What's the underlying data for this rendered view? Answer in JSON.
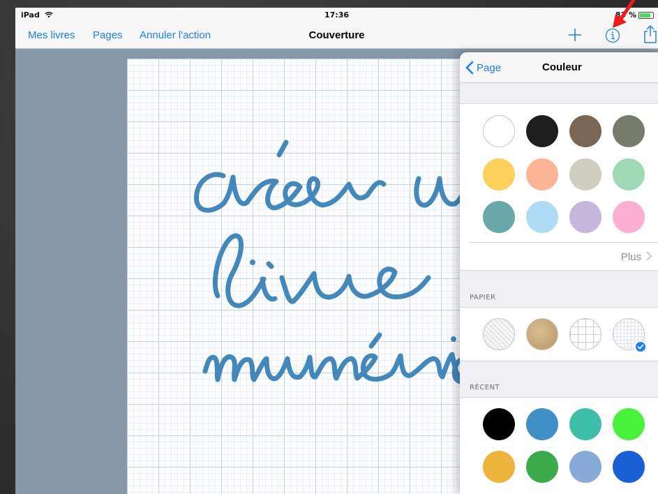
{
  "status": {
    "device": "iPad",
    "time": "17:36",
    "battery_text": "83 %",
    "battery_level": 0.83
  },
  "nav": {
    "back_books": "Mes livres",
    "pages": "Pages",
    "undo": "Annuler l'action",
    "title": "Couverture",
    "icons": [
      "plus-icon",
      "info-icon",
      "share-icon"
    ]
  },
  "canvas": {
    "handwriting": [
      "créer un",
      "livre",
      "numérique"
    ],
    "ink_color": "#4488bb"
  },
  "popover": {
    "back_label": "Page",
    "title": "Couleur",
    "colors": [
      "#ffffff",
      "#1e1e1e",
      "#7a6654",
      "#767c6c",
      "#fdcf5b",
      "#fdb497",
      "#d0ccbf",
      "#9fd8b4",
      "#6aa7ab",
      "#aedcf5",
      "#c5b6dc",
      "#fdaed3"
    ],
    "more_label": "Plus",
    "paper_label": "PAPIER",
    "papers": [
      "plain",
      "kraft",
      "grid",
      "fine-grid"
    ],
    "paper_selected": "fine-grid",
    "recent_label": "RÉCENT",
    "recent_colors": [
      "#000000",
      "#408fc6",
      "#3ebea9",
      "#48f13b",
      "#edb43c",
      "#3aaa4b",
      "#87aad8",
      "#1a5fd4"
    ]
  },
  "annotation": {
    "arrow_color": "#ee1a1a"
  }
}
